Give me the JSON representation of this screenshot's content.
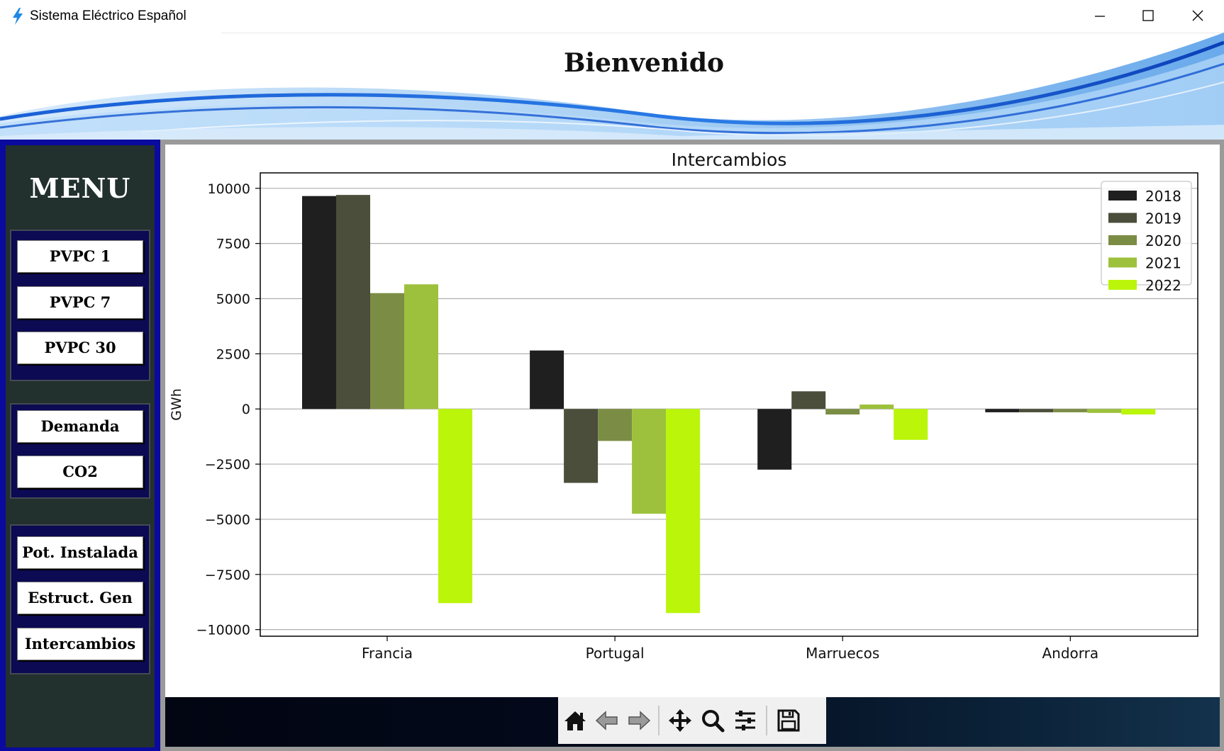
{
  "window": {
    "title": "Sistema Eléctrico Español",
    "icon": "lightning-bolt-icon",
    "controls": [
      "minimize-icon",
      "maximize-icon",
      "close-icon"
    ]
  },
  "header": {
    "title": "Bienvenido"
  },
  "sidebar": {
    "title": "MENU",
    "groups": [
      {
        "items": [
          "PVPC 1",
          "PVPC 7",
          "PVPC 30"
        ]
      },
      {
        "items": [
          "Demanda",
          "CO2"
        ]
      },
      {
        "items": [
          "Pot. Instalada",
          "Estruct. Gen",
          "Intercambios"
        ]
      }
    ]
  },
  "chart_data": {
    "type": "bar",
    "title": "Intercambios",
    "xlabel": "",
    "ylabel": "GWh",
    "categories": [
      "Francia",
      "Portugal",
      "Marruecos",
      "Andorra"
    ],
    "ylim": [
      -10300,
      10700
    ],
    "yticks": [
      10000,
      7500,
      5000,
      2500,
      0,
      -2500,
      -5000,
      -7500,
      -10000
    ],
    "ytick_labels": [
      "10000",
      "7500",
      "5000",
      "2500",
      "0",
      "−2500",
      "−5000",
      "−7500",
      "−10000"
    ],
    "grid": "horizontal",
    "legend_position": "top-right",
    "series": [
      {
        "name": "2018",
        "color": "#1f1f1f",
        "values": [
          9650,
          2650,
          -2750,
          -150
        ]
      },
      {
        "name": "2019",
        "color": "#4a4e3a",
        "values": [
          9700,
          -3350,
          800,
          -150
        ]
      },
      {
        "name": "2020",
        "color": "#7b8d45",
        "values": [
          5250,
          -1450,
          -250,
          -150
        ]
      },
      {
        "name": "2021",
        "color": "#9dc13c",
        "values": [
          5650,
          -4750,
          200,
          -180
        ]
      },
      {
        "name": "2022",
        "color": "#bbf50a",
        "values": [
          -8800,
          -9250,
          -1400,
          -250
        ]
      }
    ]
  },
  "toolbar": {
    "tools": [
      "home-icon",
      "back-arrow-icon",
      "forward-arrow-icon",
      "pan-move-icon",
      "zoom-magnifier-icon",
      "configure-subplots-icon",
      "save-disk-icon"
    ]
  }
}
